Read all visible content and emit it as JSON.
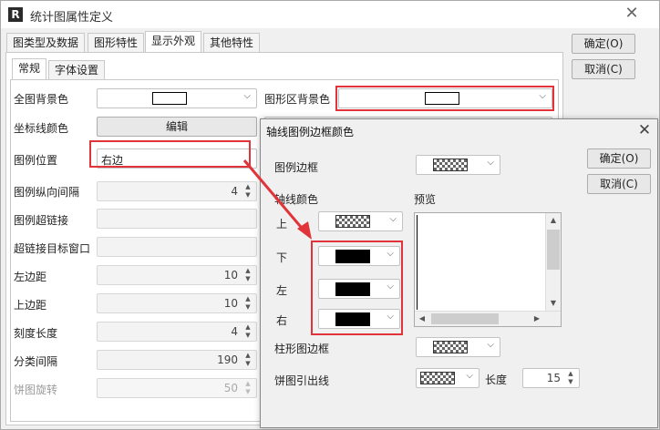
{
  "window": {
    "title": "统计图属性定义",
    "logo_text": "R",
    "close_glyph": "✕"
  },
  "tabs": [
    "图类型及数据",
    "图形特性",
    "显示外观",
    "其他特性"
  ],
  "subtabs": [
    "常规",
    "字体设置"
  ],
  "right_buttons": {
    "ok": "确定(O)",
    "cancel": "取消(C)"
  },
  "form": {
    "bg_color_label": "全图背景色",
    "axis_color_label": "坐标线颜色",
    "axis_color_button": "编辑",
    "legend_pos_label": "图例位置",
    "legend_pos_value": "右边",
    "legend_vgap_label": "图例纵向间隔",
    "legend_vgap_value": "4",
    "legend_link_label": "图例超链接",
    "link_target_label": "超链接目标窗口",
    "left_margin_label": "左边距",
    "left_margin_value": "10",
    "top_margin_label": "上边距",
    "top_margin_value": "10",
    "tick_len_label": "刻度长度",
    "tick_len_value": "4",
    "cat_gap_label": "分类间隔",
    "cat_gap_value": "190",
    "pie_rot_label": "饼图旋转",
    "pie_rot_value": "50",
    "plot_bg_label": "图形区背景色"
  },
  "dialog": {
    "title": "轴线图例边框颜色",
    "close_glyph": "✕",
    "legend_border_label": "图例边框",
    "axis_color_label": "轴线颜色",
    "preview_label": "预览",
    "top_label": "上",
    "bottom_label": "下",
    "left_label": "左",
    "right_label": "右",
    "bar_border_label": "柱形图边框",
    "pie_line_label": "饼图引出线",
    "length_label": "长度",
    "length_value": "15",
    "ok": "确定(O)",
    "cancel": "取消(C)"
  },
  "colors": {
    "highlight": "#e0343a",
    "swatch_black": "#000000",
    "swatch_white": "#ffffff"
  }
}
